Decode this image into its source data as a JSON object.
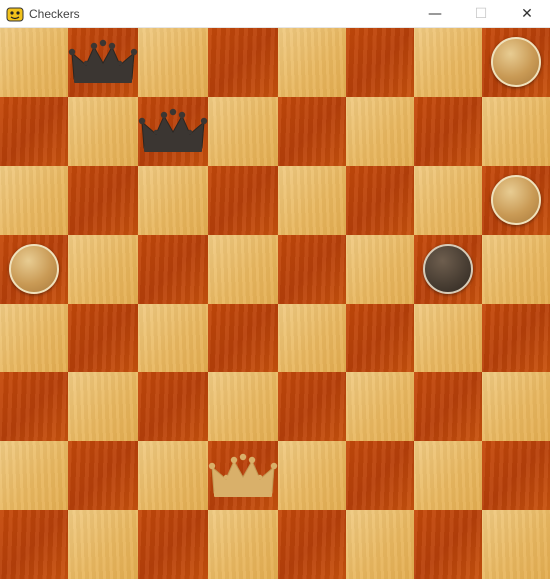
{
  "window": {
    "title": "Checkers",
    "minimize_glyph": "—",
    "maximize_glyph": "☐",
    "close_glyph": "✕"
  },
  "board": {
    "size": 8,
    "top_left_square": "light",
    "colors": {
      "light": "#efc57a",
      "dark": "#c1480b"
    },
    "pieces": [
      {
        "row": 0,
        "col": 1,
        "type": "king",
        "color": "dark"
      },
      {
        "row": 0,
        "col": 7,
        "type": "man",
        "color": "light"
      },
      {
        "row": 1,
        "col": 2,
        "type": "king",
        "color": "dark"
      },
      {
        "row": 2,
        "col": 7,
        "type": "man",
        "color": "light"
      },
      {
        "row": 3,
        "col": 0,
        "type": "man",
        "color": "light"
      },
      {
        "row": 3,
        "col": 6,
        "type": "man",
        "color": "dark"
      },
      {
        "row": 6,
        "col": 3,
        "type": "king",
        "color": "light"
      }
    ]
  },
  "icons": {
    "app": "pygame-snake-icon",
    "king": "crown-icon",
    "man": "checker-disc"
  }
}
